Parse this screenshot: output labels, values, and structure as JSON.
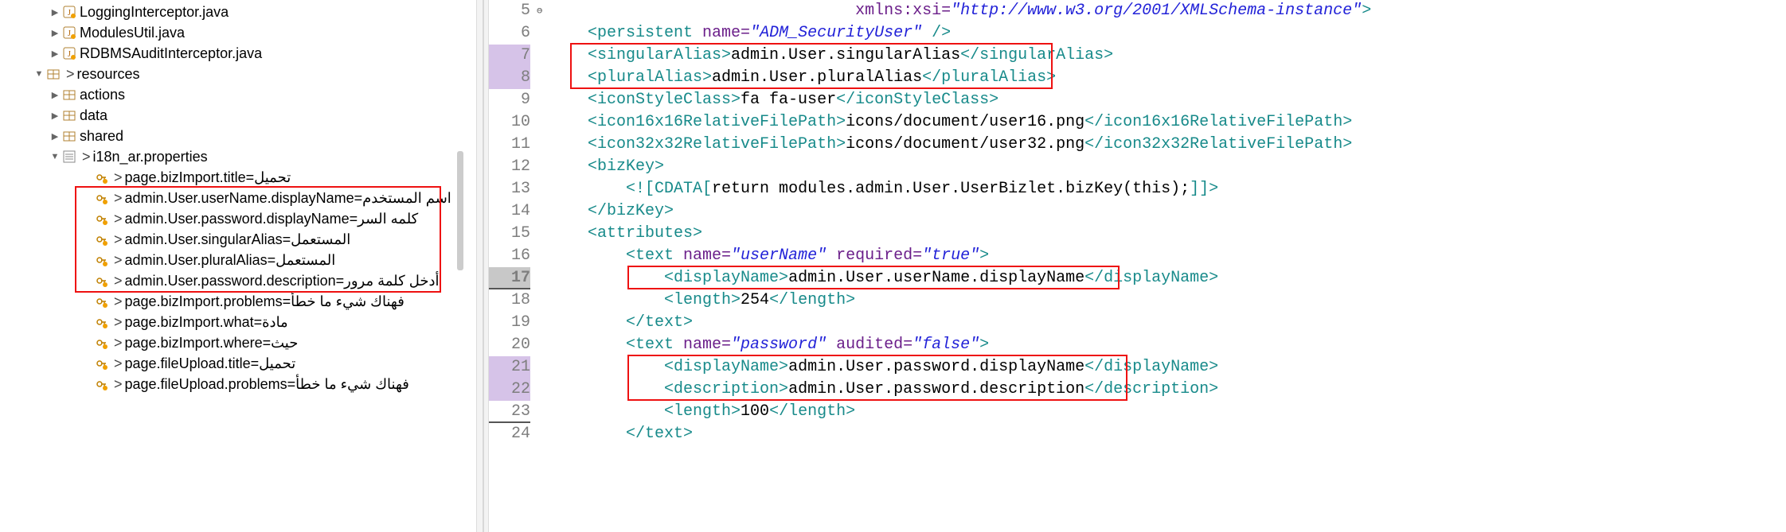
{
  "tree": {
    "files": [
      {
        "label": "LoggingInterceptor.java",
        "indent": 60,
        "arrow": "right",
        "icon": "java"
      },
      {
        "label": "ModulesUtil.java",
        "indent": 60,
        "arrow": "right",
        "icon": "java"
      },
      {
        "label": "RDBMSAuditInterceptor.java",
        "indent": 60,
        "arrow": "right",
        "icon": "java"
      }
    ],
    "resources": {
      "label": "resources",
      "indent": 40,
      "arrow": "open",
      "icon": "pkg",
      "gt": ">"
    },
    "folders": [
      {
        "label": "actions",
        "indent": 60,
        "arrow": "right",
        "icon": "pkg"
      },
      {
        "label": "data",
        "indent": 60,
        "arrow": "right",
        "icon": "pkg"
      },
      {
        "label": "shared",
        "indent": 60,
        "arrow": "right",
        "icon": "pkg"
      }
    ],
    "propfile": {
      "label": "i18n_ar.properties",
      "indent": 60,
      "arrow": "open",
      "icon": "props",
      "gt": ">"
    },
    "props": [
      {
        "label": "page.bizImport.title=تحميل",
        "gt": ">"
      },
      {
        "label": "admin.User.userName.displayName=اسم المستخدم",
        "gt": ">",
        "boxed": true
      },
      {
        "label": "admin.User.password.displayName=كلمه السر",
        "gt": ">",
        "boxed": true
      },
      {
        "label": "admin.User.singularAlias=المستعمل",
        "gt": ">",
        "boxed": true
      },
      {
        "label": "admin.User.pluralAlias=المستعمل",
        "gt": ">",
        "boxed": true
      },
      {
        "label": "admin.User.password.description=أدخل كلمة مرور",
        "gt": ">",
        "boxed": true
      },
      {
        "label": "page.bizImport.problems=فهناك شيء ما خطأ",
        "gt": ">"
      },
      {
        "label": "page.bizImport.what=مادة",
        "gt": ">"
      },
      {
        "label": "page.bizImport.where=حيث",
        "gt": ">"
      },
      {
        "label": "page.fileUpload.title=تحميل",
        "gt": ">"
      },
      {
        "label": "page.fileUpload.problems=فهناك شيء ما خطأ",
        "gt": ">"
      }
    ]
  },
  "code": {
    "lines": [
      {
        "n": 5,
        "indent": 8,
        "html": "xmlns:xsi=|STR|\"http://www.w3.org/2001/XMLSchema-instance\"|TAG|>",
        "style": "attr-lead"
      },
      {
        "n": 6,
        "indent": 1,
        "html": "|TAG|<persistent |ATTR|name=|STR|\"ADM_SecurityUser\"|TAG| />"
      },
      {
        "n": 7,
        "indent": 1,
        "html": "|TAG|<singularAlias>|TXT|admin.User.singularAlias|TAG|</singularAlias>",
        "hl": true
      },
      {
        "n": 8,
        "indent": 1,
        "html": "|TAG|<pluralAlias>|TXT|admin.User.pluralAlias|TAG|</pluralAlias>",
        "hl": true
      },
      {
        "n": 9,
        "indent": 1,
        "html": "|TAG|<iconStyleClass>|TXT|fa fa-user|TAG|</iconStyleClass>"
      },
      {
        "n": 10,
        "indent": 1,
        "html": "|TAG|<icon16x16RelativeFilePath>|TXT|icons/document/user16.png|TAG|</icon16x16RelativeFilePath>"
      },
      {
        "n": 11,
        "indent": 1,
        "html": "|TAG|<icon32x32RelativeFilePath>|TXT|icons/document/user32.png|TAG|</icon32x32RelativeFilePath>"
      },
      {
        "n": 12,
        "indent": 1,
        "html": "|TAG|<bizKey>",
        "fold": "⊖"
      },
      {
        "n": 13,
        "indent": 2,
        "html": "|TAG|<![CDATA[|TXT|return modules.admin.User.UserBizlet.bizKey(this);|TAG|]]>"
      },
      {
        "n": 14,
        "indent": 1,
        "html": "|TAG|</bizKey>"
      },
      {
        "n": 15,
        "indent": 1,
        "html": "|TAG|<attributes>",
        "fold": "⊖"
      },
      {
        "n": 16,
        "indent": 2,
        "html": "|TAG|<text |ATTR|name=|STR|\"userName\"|TAG| |ATTR|required=|STR|\"true\"|TAG|>",
        "fold": "⊖"
      },
      {
        "n": 17,
        "indent": 3,
        "html": "|TAG|<displayName>|TXT|admin.User.userName.displayName|TAG|</displayName>",
        "hl2": true
      },
      {
        "n": 18,
        "indent": 3,
        "html": "|TAG|<length>|TXT|254|TAG|</length>"
      },
      {
        "n": 19,
        "indent": 2,
        "html": "|TAG|</text>"
      },
      {
        "n": 20,
        "indent": 2,
        "html": "|TAG|<text |ATTR|name=|STR|\"password\"|TAG| |ATTR|audited=|STR|\"false\"|TAG|>",
        "fold": "⊖"
      },
      {
        "n": 21,
        "indent": 3,
        "html": "|TAG|<displayName>|TXT|admin.User.password.displayName|TAG|</displayName>",
        "hl": true
      },
      {
        "n": 22,
        "indent": 3,
        "html": "|TAG|<description>|TXT|admin.User.password.description|TAG|</description>",
        "hl": true
      },
      {
        "n": 23,
        "indent": 3,
        "html": "|TAG|<length>|TXT|100|TAG|</length>",
        "uline": true
      },
      {
        "n": 24,
        "indent": 2,
        "html": "|TAG|</text>"
      }
    ]
  },
  "chart_data": null
}
